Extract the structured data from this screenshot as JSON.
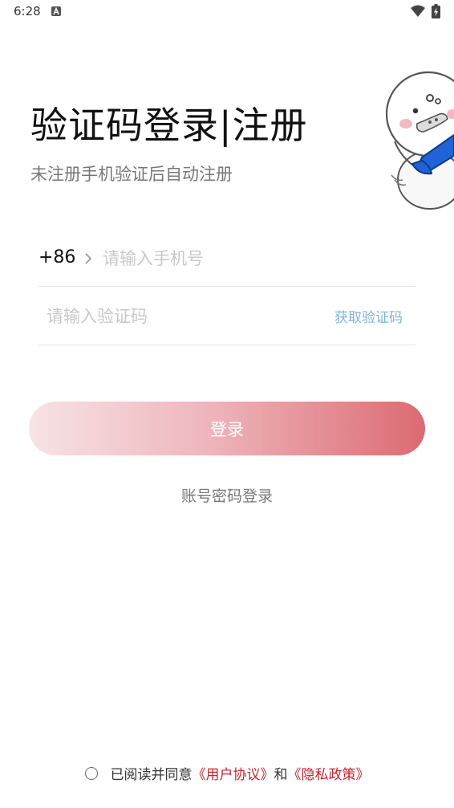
{
  "status_bar": {
    "time": "6:28"
  },
  "header": {
    "title": "验证码登录|注册",
    "subtitle": "未注册手机验证后自动注册"
  },
  "form": {
    "country_code": "+86",
    "phone_placeholder": "请输入手机号",
    "code_placeholder": "请输入验证码",
    "get_code_label": "获取验证码"
  },
  "actions": {
    "login_label": "登录",
    "password_login_label": "账号密码登录"
  },
  "agreement": {
    "prefix": "已阅读并同意",
    "user_agreement": "《用户协议》",
    "conjunction": "和",
    "privacy_policy": "《隐私政策》"
  },
  "colors": {
    "accent_link": "#7fb3dc",
    "agreement_link": "#c6222f",
    "button_gradient_start": "#f7e3e5",
    "button_gradient_end": "#dc6a72"
  },
  "icons": {
    "status_app": "notification-app-icon",
    "wifi": "wifi-icon",
    "battery": "battery-charging-icon",
    "chevron": "chevron-right-icon",
    "mascot": "mascot-illustration",
    "radio": "radio-unchecked-icon"
  }
}
